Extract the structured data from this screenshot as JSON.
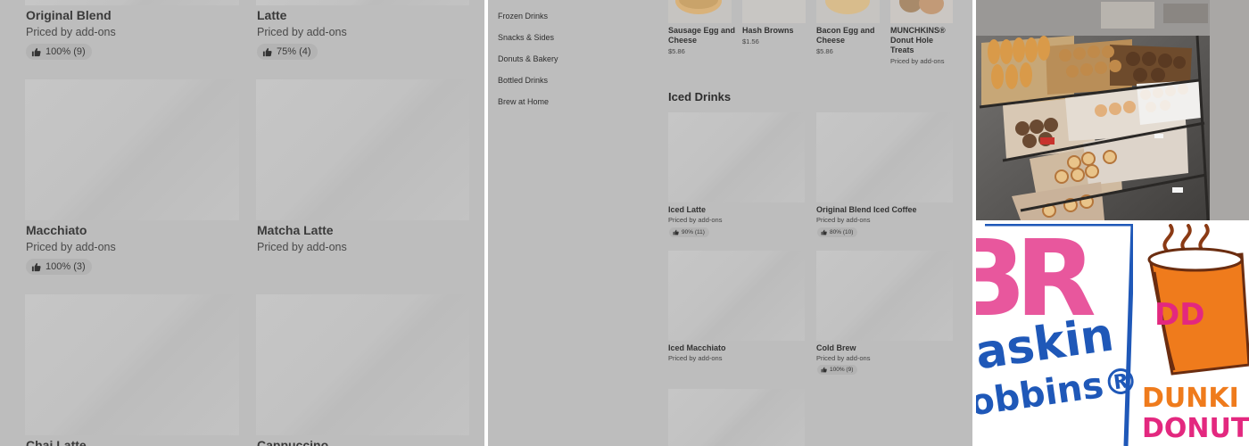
{
  "left_panel": {
    "items": [
      {
        "name": "Original Blend",
        "subtitle": "Priced by add-ons",
        "rating": "100% (9)"
      },
      {
        "name": "Latte",
        "subtitle": "Priced by add-ons",
        "rating": "75% (4)"
      },
      {
        "name": "Macchiato",
        "subtitle": "Priced by add-ons",
        "rating": "100% (3)"
      },
      {
        "name": "Matcha Latte",
        "subtitle": "Priced by add-ons"
      },
      {
        "name": "Chai Latte"
      },
      {
        "name": "Cappuccino"
      }
    ]
  },
  "middle_panel": {
    "nav": [
      "Frozen Drinks",
      "Snacks & Sides",
      "Donuts & Bakery",
      "Bottled Drinks",
      "Brew at Home"
    ],
    "top_items": [
      {
        "name": "Sausage Egg and Cheese",
        "price": "$5.86"
      },
      {
        "name": "Hash Browns",
        "price": "$1.56"
      },
      {
        "name": "Bacon Egg and Cheese",
        "price": "$5.86"
      },
      {
        "name": "MUNCHKINS® Donut Hole Treats",
        "price": "Priced by add-ons"
      }
    ],
    "section_title": "Iced Drinks",
    "iced_items": [
      {
        "name": "Iced Latte",
        "subtitle": "Priced by add-ons",
        "rating": "90% (11)"
      },
      {
        "name": "Original Blend Iced Coffee",
        "subtitle": "Priced by add-ons",
        "rating": "80% (10)"
      },
      {
        "name": "Iced Macchiato",
        "subtitle": "Priced by add-ons"
      },
      {
        "name": "Cold Brew",
        "subtitle": "Priced by add-ons",
        "rating": "100% (9)"
      }
    ]
  },
  "right_panel": {
    "logo_br_letters": "BR",
    "logo_br_text": [
      "askin",
      "obbins®"
    ],
    "logo_dd_text": [
      "DUNKI",
      "DONUT"
    ],
    "logo_dd_cup": "DD",
    "brand_colors": {
      "pink": "#e8579d",
      "blue": "#1f58b8",
      "orange": "#ef7b1c",
      "magenta": "#e3287f"
    }
  }
}
